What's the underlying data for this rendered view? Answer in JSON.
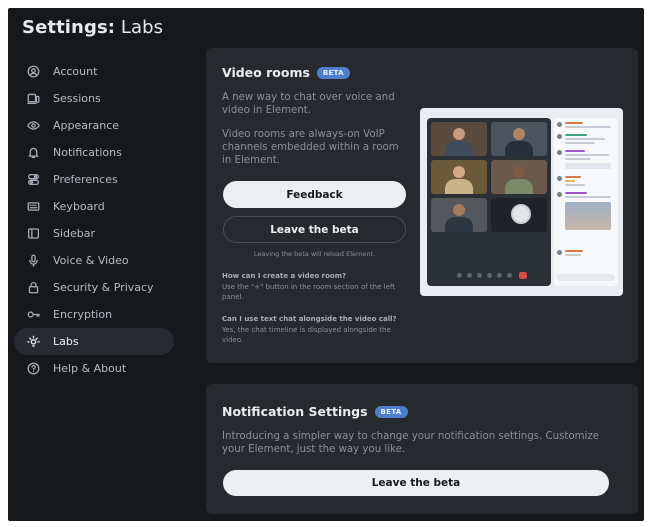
{
  "header": {
    "prefix": "Settings:",
    "section": "Labs"
  },
  "sidebar": {
    "items": [
      {
        "label": "Account",
        "icon": "account-icon"
      },
      {
        "label": "Sessions",
        "icon": "devices-icon"
      },
      {
        "label": "Appearance",
        "icon": "eye-icon"
      },
      {
        "label": "Notifications",
        "icon": "bell-icon"
      },
      {
        "label": "Preferences",
        "icon": "preferences-icon"
      },
      {
        "label": "Keyboard",
        "icon": "keyboard-icon"
      },
      {
        "label": "Sidebar",
        "icon": "sidebar-icon"
      },
      {
        "label": "Voice & Video",
        "icon": "microphone-icon"
      },
      {
        "label": "Security & Privacy",
        "icon": "lock-icon"
      },
      {
        "label": "Encryption",
        "icon": "key-icon"
      },
      {
        "label": "Labs",
        "icon": "lab-icon",
        "active": true
      },
      {
        "label": "Help & About",
        "icon": "help-icon"
      }
    ]
  },
  "video_rooms": {
    "title": "Video rooms",
    "badge": "BETA",
    "desc1": "A new way to chat over voice and video in Element.",
    "desc2": "Video rooms are always-on VoIP channels embedded within a room in Element.",
    "feedback_label": "Feedback",
    "leave_label": "Leave the beta",
    "reload_note": "Leaving the beta will reload Element.",
    "faq": [
      {
        "q": "How can I create a video room?",
        "a": "Use the \"+\" button in the room section of the left panel."
      },
      {
        "q": "Can I use text chat alongside the video call?",
        "a": "Yes, the chat timeline is displayed alongside the video."
      }
    ]
  },
  "notification_settings": {
    "title": "Notification Settings",
    "badge": "BETA",
    "desc": "Introducing a simpler way to change your notification settings. Customize your Element, just the way you like.",
    "leave_label": "Leave the beta"
  },
  "colors": {
    "background": "#16181c",
    "card": "#26292e",
    "accent": "#4f7fcc",
    "active_item": "#272a30"
  }
}
